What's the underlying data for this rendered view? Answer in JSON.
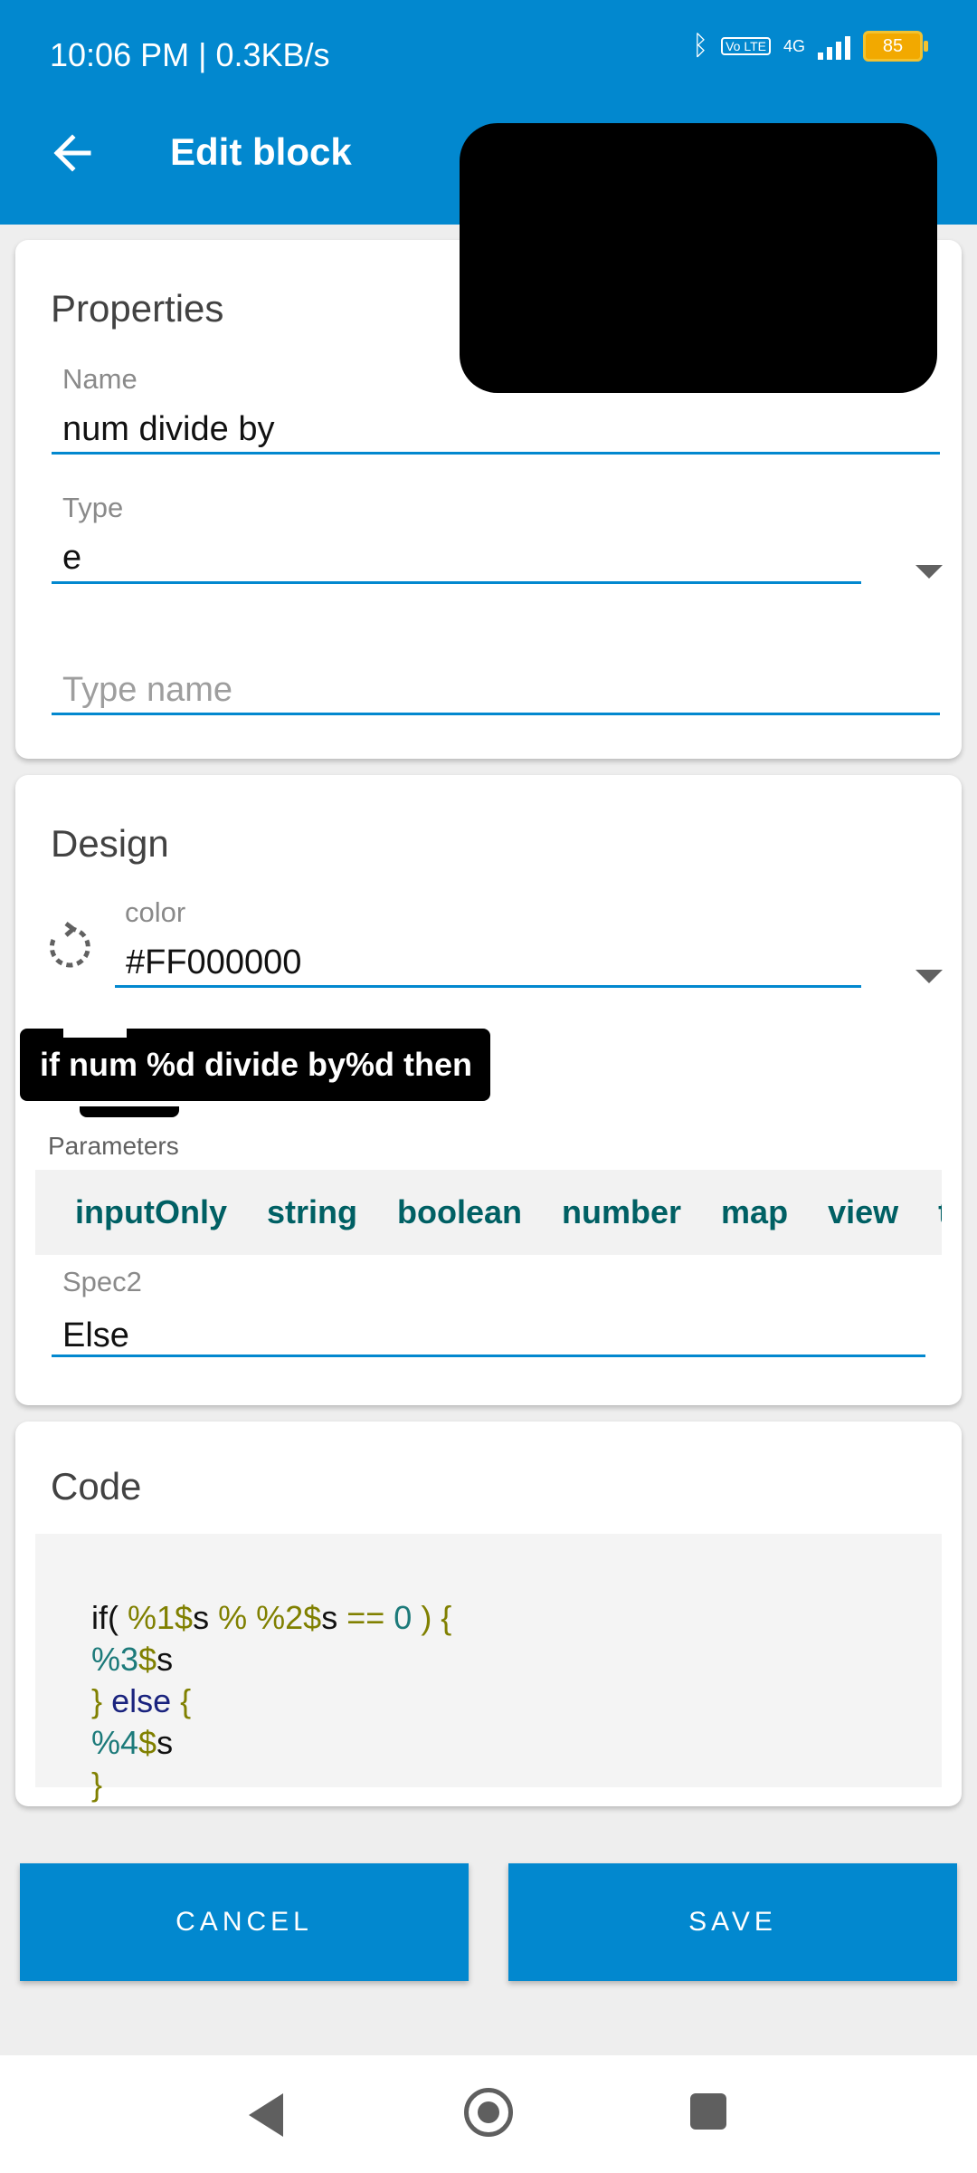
{
  "status": {
    "time": "10:06 PM | 0.3KB/s",
    "network": "4G",
    "volte": "Vo LTE",
    "battery": "85"
  },
  "appbar": {
    "title": "Edit block",
    "back_icon": "arrow-left-icon"
  },
  "properties": {
    "title": "Properties",
    "name_label": "Name",
    "name_value": "num divide by",
    "type_label": "Type",
    "type_value": "e",
    "type_name_placeholder": "Type name"
  },
  "design": {
    "title": "Design",
    "color_label": "color",
    "color_value": "#FF000000",
    "block_preview": "if num %d divide by%d  then",
    "parameters_label": "Parameters",
    "parameters": [
      "inputOnly",
      "string",
      "boolean",
      "number",
      "map",
      "view",
      "t"
    ],
    "spec2_label": "Spec2",
    "spec2_value": "Else"
  },
  "code": {
    "title": "Code",
    "lines": [
      "if( %1$s % %2$s == 0 ) {",
      "%3$s",
      "} else {",
      "%4$s",
      "}"
    ]
  },
  "buttons": {
    "cancel": "CANCEL",
    "save": "SAVE"
  },
  "colors": {
    "primary": "#0288cf",
    "param_text": "#006064"
  }
}
